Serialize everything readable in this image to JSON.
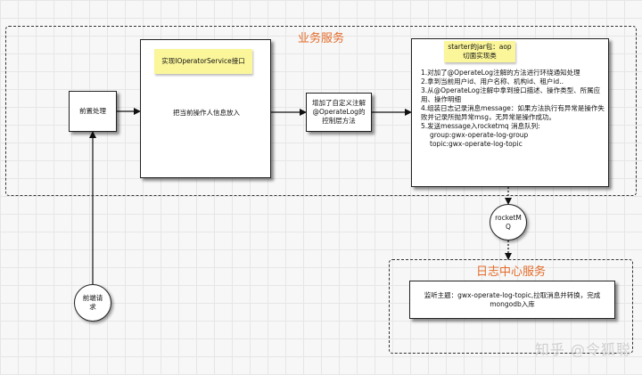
{
  "groups": {
    "business": {
      "title": "业务服务"
    },
    "log_center": {
      "title": "日志中心服务"
    }
  },
  "nodes": {
    "preprocess": "前置处理",
    "put_operator": "把当前操作人信息放入",
    "custom_annotation": "增加了自定义注解@OperateLog的控制层方法",
    "aop_steps": [
      "1.对加了@OperateLog注解的方法进行环绕通知处理",
      "2.拿到当前用户id、用户名称、机构id、租户id..",
      "3.从@OperateLog注解中拿到接口描述、操作类型、所属应用、操作明细",
      "4.组装日志记录消息message：如果方法执行有异常是操作失败并记录所抛异常msg，无异常是操作成功。",
      "5.发送message入rocketmq 消息队列:",
      "group:gwx-operate-log-group",
      "topic:gwx-operate-log-topic"
    ],
    "rocketmq": "rocketMQ",
    "frontend_request": "前端请求",
    "listen_topic": "监听主题：gwx-operate-log-topic,拉取消息并转换，完成mongodb入库"
  },
  "notes": {
    "iface_note": "实现IOperatorService接口",
    "aop_note": "starter的jar包：aop切面实现类"
  },
  "watermark": "知乎 @令狐聪"
}
